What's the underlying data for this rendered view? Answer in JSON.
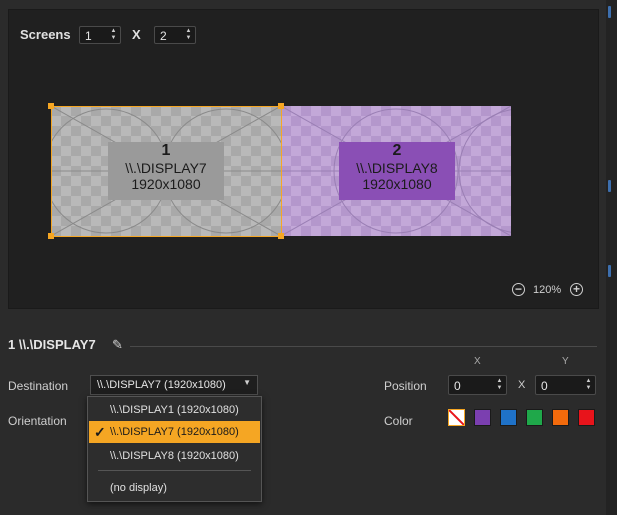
{
  "screens": {
    "label": "Screens",
    "rows": "1",
    "sep": "X",
    "cols": "2"
  },
  "displays": [
    {
      "index": "1",
      "name": "\\\\.\\DISPLAY7",
      "resolution": "1920x1080",
      "color": "#9a9a9a"
    },
    {
      "index": "2",
      "name": "\\\\.\\DISPLAY8",
      "resolution": "1920x1080",
      "color": "#8a4fb5"
    }
  ],
  "zoom": {
    "value": "120%",
    "minus_icon": "zoom-out-icon",
    "plus_icon": "zoom-in-icon"
  },
  "section": {
    "title": "1  \\\\.\\DISPLAY7",
    "edit_icon": "pencil-icon"
  },
  "destination": {
    "label": "Destination",
    "value": "\\\\.\\DISPLAY7 (1920x1080)",
    "options": [
      "\\\\.\\DISPLAY1 (1920x1080)",
      "\\\\.\\DISPLAY7 (1920x1080)",
      "\\\\.\\DISPLAY8 (1920x1080)",
      "(no display)"
    ],
    "selected_index": 1
  },
  "orientation": {
    "label": "Orientation"
  },
  "position": {
    "label": "Position",
    "x_header": "X",
    "y_header": "Y",
    "x": "0",
    "y": "0",
    "sep": "X"
  },
  "color": {
    "label": "Color",
    "swatches": [
      "none",
      "#7b3fb0",
      "#1f72c8",
      "#1fa84a",
      "#f26a0c",
      "#e8141b"
    ],
    "selected": "none"
  },
  "accent": "#f5a623"
}
